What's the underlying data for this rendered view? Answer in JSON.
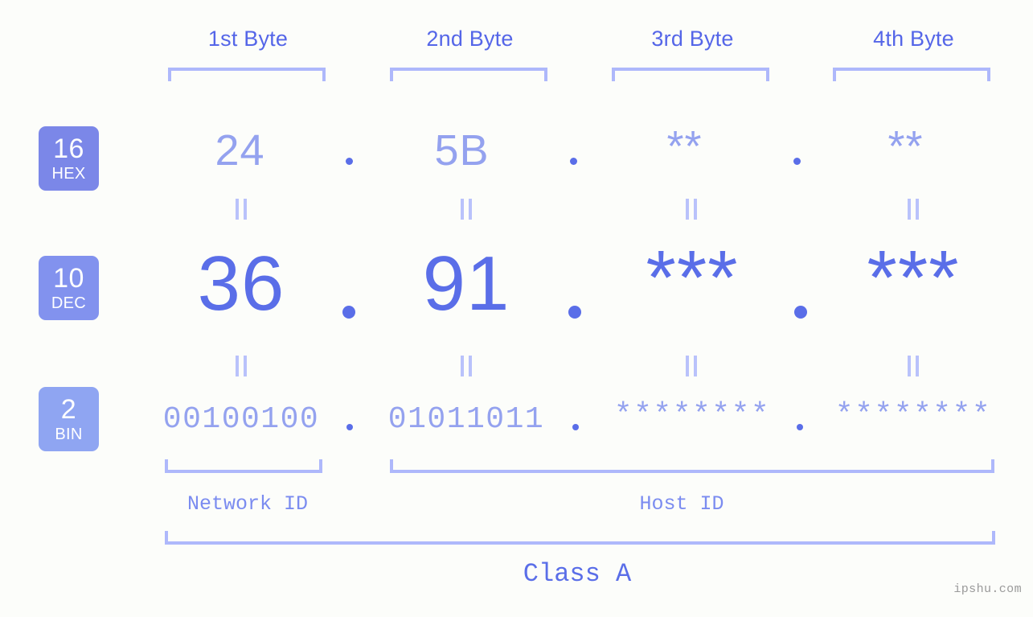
{
  "meta": {
    "watermark": "ipshu.com",
    "background": "#fcfdfa"
  },
  "colors": {
    "accent_dark": "#5a6ee8",
    "accent_light": "#94a2ef",
    "bracket": "#aeb8fb",
    "badge_hex": "#7b87e8",
    "badge_dec": "#8292ee",
    "badge_bin": "#8fa5f2",
    "byte_label": "#5566e8",
    "watermark": "#9a9a9a"
  },
  "byte_headers": [
    {
      "label": "1st Byte"
    },
    {
      "label": "2nd Byte"
    },
    {
      "label": "3rd Byte"
    },
    {
      "label": "4th Byte"
    }
  ],
  "rows": [
    {
      "id": "hex",
      "badge_number": "16",
      "badge_name": "HEX",
      "values": [
        "24",
        "5B",
        "**",
        "**"
      ],
      "separator": "."
    },
    {
      "id": "dec",
      "badge_number": "10",
      "badge_name": "DEC",
      "values": [
        "36",
        "91",
        "***",
        "***"
      ],
      "separator": "."
    },
    {
      "id": "bin",
      "badge_number": "2",
      "badge_name": "BIN",
      "values": [
        "00100100",
        "01011011",
        "********",
        "********"
      ],
      "separator": "."
    }
  ],
  "equals_marker": "=",
  "footer": {
    "network_id": "Network ID",
    "host_id": "Host ID",
    "class_label": "Class A"
  }
}
